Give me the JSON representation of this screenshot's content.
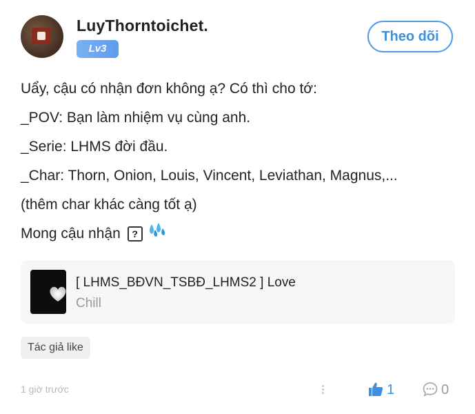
{
  "post": {
    "author": "LuyThorntoichet.",
    "level": "Lv3",
    "follow_label": "Theo dõi",
    "lines": [
      "Uẩy, cậu có nhận đơn không ạ? Có thì cho tớ:",
      "_POV: Bạn làm nhiệm vụ cùng anh.",
      "_Serie: LHMS đời đầu.",
      "_Char: Thorn, Onion, Louis, Vincent, Leviathan, Magnus,...",
      "(thêm char khác càng tốt ạ)",
      "Mong cậu nhận"
    ],
    "unknown_emoji": "?",
    "music": {
      "title": "[ LHMS_BĐVN_TSBĐ_LHMS2 ] Love",
      "subtitle": "Chill"
    },
    "tag": "Tác giả like",
    "time": "1 giờ trước",
    "likes": "1",
    "comments": "0"
  },
  "colors": {
    "accent": "#3d8fe0",
    "level_badge": "#6aa6ef",
    "card_bg": "#f5f6f7"
  },
  "icons": [
    "avatar",
    "question-box-icon",
    "sweat-drops-icon",
    "heart-icon",
    "more-dots-icon",
    "thumbs-up-icon",
    "comment-icon"
  ]
}
